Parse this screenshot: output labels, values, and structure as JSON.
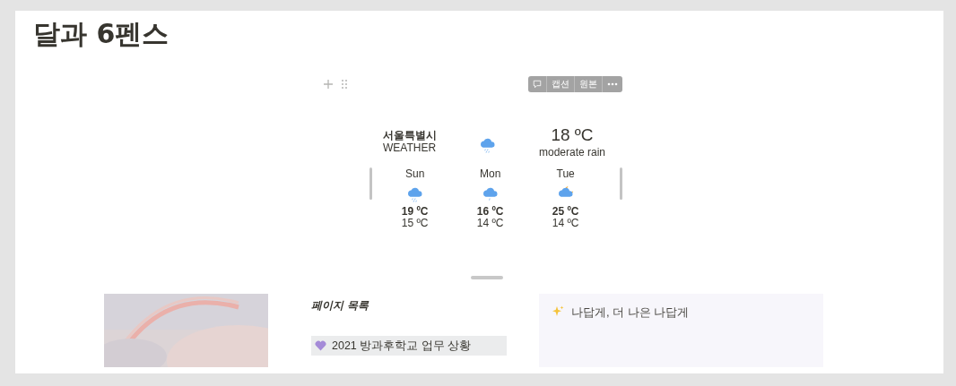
{
  "page_title": "달과 6펜스",
  "toolbar": {
    "buttons": [
      {
        "kind": "comment"
      },
      {
        "kind": "text",
        "label": "캡션"
      },
      {
        "kind": "text",
        "label": "원본"
      },
      {
        "kind": "more"
      }
    ]
  },
  "weather": {
    "city": "서울특별시",
    "subtitle": "WEATHER",
    "current": {
      "kind": "rain",
      "temperature": "18 ºC",
      "description": "moderate rain"
    },
    "forecast": [
      {
        "day": "Sun",
        "kind": "rain",
        "high": "19 ºC",
        "low": "15 ºC"
      },
      {
        "day": "Mon",
        "kind": "drizzle",
        "high": "16 ºC",
        "low": "14 ºC"
      },
      {
        "day": "Tue",
        "kind": "cloud-moon",
        "high": "25 ºC",
        "low": "14 ºC"
      }
    ]
  },
  "columns": {
    "page_list": {
      "heading": "페이지 목록",
      "items": [
        {
          "label": "2021 방과후학교 업무 상황"
        }
      ]
    },
    "callout": {
      "text": "나답게, 더 나은 나답게"
    }
  }
}
